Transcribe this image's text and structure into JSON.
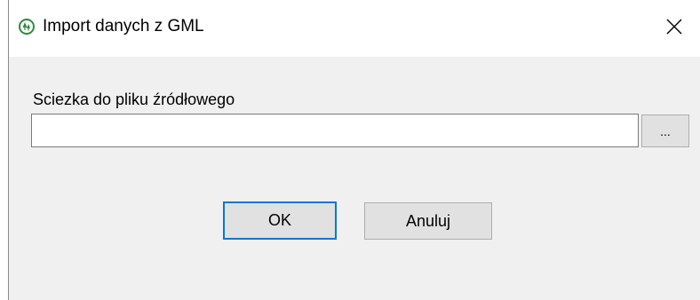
{
  "window": {
    "title": "Import danych z GML",
    "icon": "app-tree-logo-icon",
    "close_icon": "close-icon"
  },
  "form": {
    "path_label": "Sciezka do pliku źródłowego",
    "path_value": "",
    "browse_label": "..."
  },
  "buttons": {
    "ok_label": "OK",
    "cancel_label": "Anuluj"
  },
  "colors": {
    "dialog_bg": "#f0f0f0",
    "titlebar_bg": "#ffffff",
    "accent": "#0078d7",
    "icon_green": "#2e8b3e"
  }
}
